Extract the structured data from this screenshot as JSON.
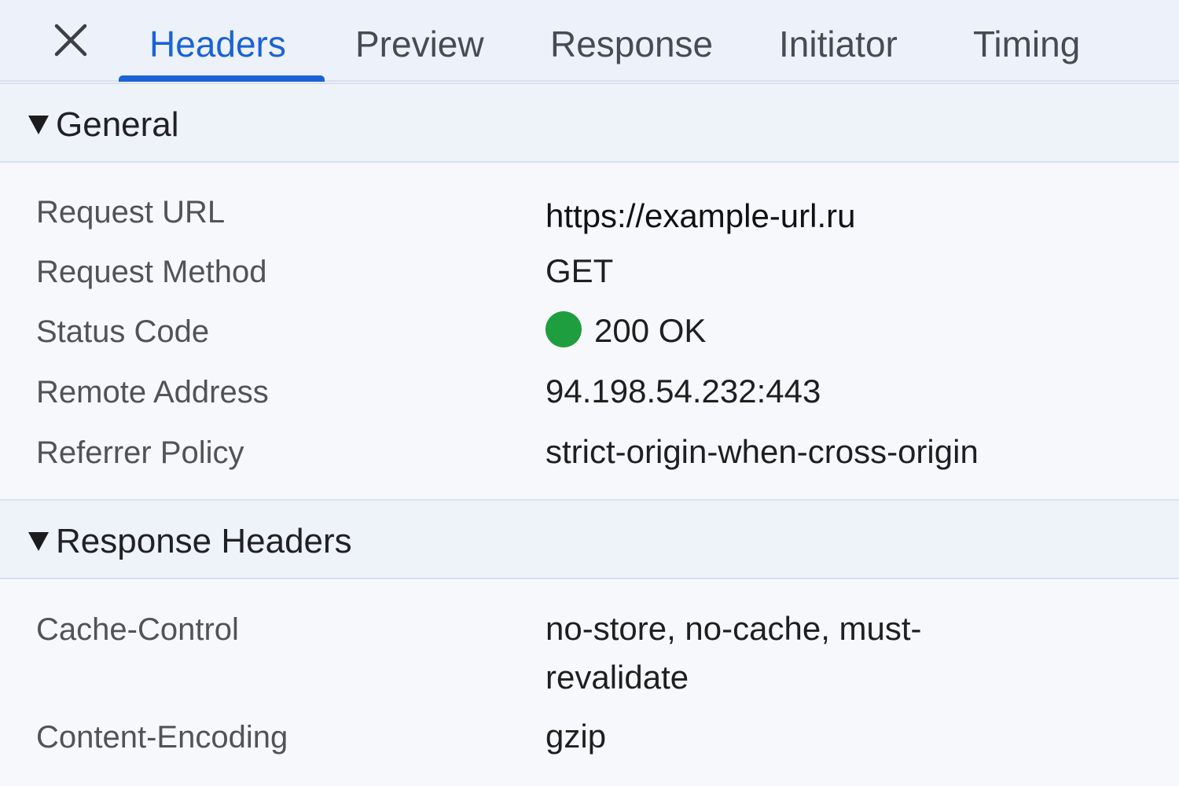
{
  "tabs": [
    {
      "label": "Headers",
      "active": true
    },
    {
      "label": "Preview",
      "active": false
    },
    {
      "label": "Response",
      "active": false
    },
    {
      "label": "Initiator",
      "active": false
    },
    {
      "label": "Timing",
      "active": false
    }
  ],
  "close_icon": "close-icon",
  "accent_color": "#1a63d6",
  "general": {
    "title": "General",
    "rows": [
      {
        "key": "Request URL",
        "value": "https://example-url.ru"
      },
      {
        "key": "Request Method",
        "value": "GET"
      },
      {
        "key": "Status Code",
        "value": "200 OK",
        "status_color": "#1f9e3f"
      },
      {
        "key": "Remote Address",
        "value": "94.198.54.232:443"
      },
      {
        "key": "Referrer Policy",
        "value": "strict-origin-when-cross-origin"
      }
    ]
  },
  "response_headers": {
    "title": "Response Headers",
    "rows": [
      {
        "key": "Cache-Control",
        "value": "no-store, no-cache, must-revalidate"
      },
      {
        "key": "Content-Encoding",
        "value": "gzip"
      }
    ]
  }
}
